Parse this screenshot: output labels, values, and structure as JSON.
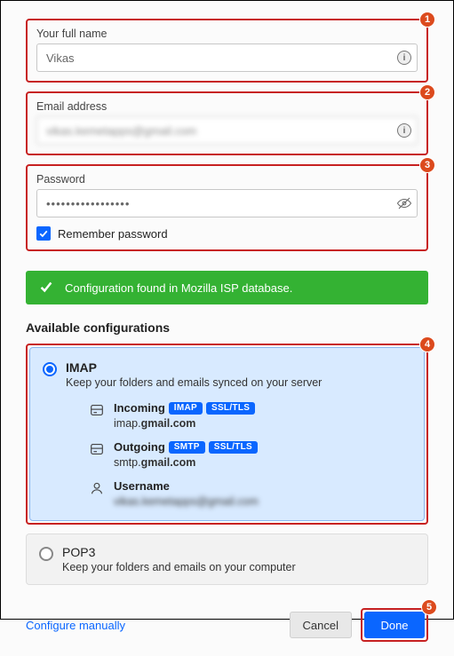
{
  "fields": {
    "name": {
      "label": "Your full name",
      "value": "Vikas"
    },
    "email": {
      "label": "Email address",
      "value": "vikas.kemetapps@gmail.com"
    },
    "password": {
      "label": "Password",
      "value": "•••••••••••••••••",
      "remember_label": "Remember password",
      "remember_checked": true
    }
  },
  "status": {
    "text": "Configuration found in Mozilla ISP database."
  },
  "section_title": "Available configurations",
  "configs": {
    "imap": {
      "title": "IMAP",
      "desc": "Keep your folders and emails synced on your server",
      "incoming": {
        "label": "Incoming",
        "proto": "IMAP",
        "security": "SSL/TLS",
        "host_prefix": "imap.",
        "host_bold": "gmail.com"
      },
      "outgoing": {
        "label": "Outgoing",
        "proto": "SMTP",
        "security": "SSL/TLS",
        "host_prefix": "smtp.",
        "host_bold": "gmail.com"
      },
      "username": {
        "label": "Username",
        "value": "vikas.kemetapps@gmail.com"
      }
    },
    "pop3": {
      "title": "POP3",
      "desc": "Keep your folders and emails on your computer"
    }
  },
  "footer": {
    "manual": "Configure manually",
    "cancel": "Cancel",
    "done": "Done"
  },
  "callouts": {
    "c1": "1",
    "c2": "2",
    "c3": "3",
    "c4": "4",
    "c5": "5"
  }
}
